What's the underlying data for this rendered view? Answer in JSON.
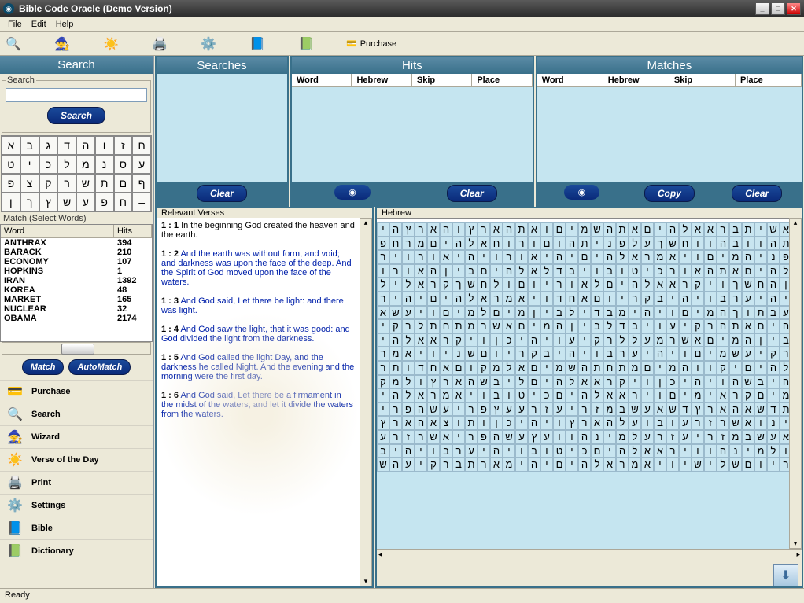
{
  "window": {
    "title": "Bible Code Oracle (Demo Version)"
  },
  "menu": {
    "file": "File",
    "edit": "Edit",
    "help": "Help"
  },
  "toolbar": {
    "purchase": "Purchase"
  },
  "left": {
    "title": "Search",
    "group_label": "Search",
    "search_btn": "Search",
    "heb_keys": [
      "א",
      "ב",
      "ג",
      "ד",
      "ה",
      "ו",
      "ז",
      "ח",
      "ט",
      "י",
      "כ",
      "ל",
      "מ",
      "נ",
      "ס",
      "ע",
      "פ",
      "צ",
      "ק",
      "ר",
      "ש",
      "ת",
      "ם",
      "ף",
      "ן",
      "ך",
      "ץ",
      "ש",
      "ע",
      "פ",
      "ח",
      "–"
    ],
    "match_label": "Match (Select Words)",
    "col_word": "Word",
    "col_hits": "Hits",
    "words": [
      {
        "w": "ANTHRAX",
        "h": "394"
      },
      {
        "w": "BARACK",
        "h": "210"
      },
      {
        "w": "ECONOMY",
        "h": "107"
      },
      {
        "w": "HOPKINS",
        "h": "1"
      },
      {
        "w": "IRAN",
        "h": "1392"
      },
      {
        "w": "KOREA",
        "h": "48"
      },
      {
        "w": "MARKET",
        "h": "165"
      },
      {
        "w": "NUCLEAR",
        "h": "32"
      },
      {
        "w": "OBAMA",
        "h": "2174"
      }
    ],
    "match_btn": "Match",
    "automatch_btn": "AutoMatch",
    "nav": [
      {
        "icon": "💳",
        "label": "Purchase"
      },
      {
        "icon": "🔍",
        "label": "Search"
      },
      {
        "icon": "🧙",
        "label": "Wizard"
      },
      {
        "icon": "☀️",
        "label": "Verse of the Day"
      },
      {
        "icon": "🖨️",
        "label": "Print"
      },
      {
        "icon": "⚙️",
        "label": "Settings"
      },
      {
        "icon": "📘",
        "label": "Bible"
      },
      {
        "icon": "📗",
        "label": "Dictionary"
      }
    ]
  },
  "panels": {
    "searches": {
      "title": "Searches",
      "clear": "Clear"
    },
    "hits": {
      "title": "Hits",
      "cols": [
        "Word",
        "Hebrew",
        "Skip",
        "Place"
      ],
      "clear": "Clear"
    },
    "matches": {
      "title": "Matches",
      "cols": [
        "Word",
        "Hebrew",
        "Skip",
        "Place"
      ],
      "copy": "Copy",
      "clear": "Clear"
    }
  },
  "verses": {
    "title": "Relevant Verses",
    "items": [
      {
        "ref": "1 : 1",
        "txt": "In the beginning God created the heaven and the earth."
      },
      {
        "ref": "1 : 2",
        "txt": "And the earth was without form, and void; and darkness was upon the face of the deep. And the Spirit of God moved upon the face of the waters."
      },
      {
        "ref": "1 : 3",
        "txt": "And God said, Let there be light: and there was light."
      },
      {
        "ref": "1 : 4",
        "txt": "And God saw the light, that it was good: and God divided the light from the darkness."
      },
      {
        "ref": "1 : 5",
        "txt": "And God called the light Day, and the darkness he called Night. And the evening and the morning were the first day."
      },
      {
        "ref": "1 : 6",
        "txt": "And God said, Let there be a firmament in the midst of the waters, and let it divide the waters from the waters."
      }
    ]
  },
  "hebrew": {
    "title": "Hebrew",
    "rows": [
      "בראשיתבראאלהיםאתהשמיםואתהארץוהארץהי",
      "תהתהוובהווחשךעלפניתהוםורוחאלהיםמרחפ",
      "תעלפניהמיםויאמראלהיםיהיאורויהיאורויר",
      "אאלהיםאתהאורכיטובויבדלאלהיםביןהאורו",
      "ביןהחשךויקראאלהיםלאוריוםולחשךקראליל",
      "הויהיערבויהיבקריוםאחדויאמראלהיםיהיר",
      "קיעבתוךהמיםויהימבדילביןמיםלמיםויעשא",
      "להיםאתהרקיעויבדלביןהמיםאשרמתחתלרקי",
      "עוביןהמיםאשרמעללרקיעויהיכןויקראאלהי",
      "םלרקיעשמיםויהיערבויהיבקריוםשניויאמר",
      "אלהיםיקווהמיםמתחתהשמיםאלמקוםאחדותר",
      "אההיבשהויהיכןויקראאלהיםליבשהארץולמק",
      "והמיםקראימיםויראאלהיםכיטובויאמראלהי",
      "םתדשאהארץדשאעשבמזריעזרעעץפריעשהפרי",
      "למינואשרזרעובועלהארץויהיכןותוצאהארץ",
      "דשאעשבמזריעזרעלמינהוועץעשהפריאשרזרע",
      "ובולמינהוויראאלהיםכיטובויהיערבויהיב",
      "קריוםשלישיויאמראלהיםיהימארתברקיעהש"
    ]
  },
  "status": "Ready"
}
